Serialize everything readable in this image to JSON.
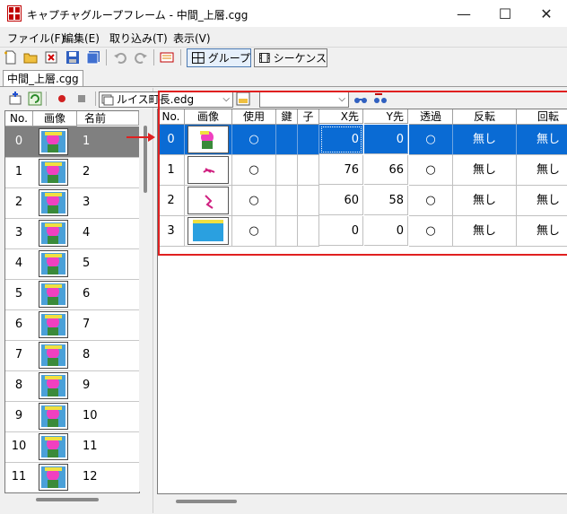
{
  "window": {
    "title": "キャプチャグループフレーム - 中間_上層.cgg"
  },
  "window_controls": {
    "minimize": "—",
    "maximize": "☐",
    "close": "✕"
  },
  "menu": [
    "ファイル(F)",
    "編集(E)",
    "取り込み(T)",
    "表示(V)"
  ],
  "toolbar": {
    "group_label": "グループ",
    "sequence_label": "シーケンス"
  },
  "doc_tab": {
    "label": "中間_上層.cgg"
  },
  "left_panel": {
    "headers": {
      "no": "No.",
      "image": "画像",
      "name": "名前"
    },
    "rows": [
      {
        "no": "0",
        "name": "1",
        "selected": true
      },
      {
        "no": "1",
        "name": "2"
      },
      {
        "no": "2",
        "name": "3"
      },
      {
        "no": "3",
        "name": "4"
      },
      {
        "no": "4",
        "name": "5"
      },
      {
        "no": "5",
        "name": "6"
      },
      {
        "no": "6",
        "name": "7"
      },
      {
        "no": "7",
        "name": "8"
      },
      {
        "no": "8",
        "name": "9"
      },
      {
        "no": "9",
        "name": "10"
      },
      {
        "no": "10",
        "name": "11"
      },
      {
        "no": "11",
        "name": "12"
      }
    ]
  },
  "right_panel": {
    "file_combo": "ルイス町長.edg",
    "second_combo": "",
    "headers": {
      "no": "No.",
      "image": "画像",
      "use": "使用",
      "key": "鍵",
      "child": "子",
      "x": "X先",
      "y": "Y先",
      "transparent": "透過",
      "flip": "反転",
      "rotate": "回転"
    },
    "rows": [
      {
        "no": "0",
        "use": "○",
        "key": "",
        "child": "",
        "x": "0",
        "y": "0",
        "transparent": "○",
        "flip": "無し",
        "rotate": "無し",
        "selected": true
      },
      {
        "no": "1",
        "use": "○",
        "key": "",
        "child": "",
        "x": "76",
        "y": "66",
        "transparent": "○",
        "flip": "無し",
        "rotate": "無し"
      },
      {
        "no": "2",
        "use": "○",
        "key": "",
        "child": "",
        "x": "60",
        "y": "58",
        "transparent": "○",
        "flip": "無し",
        "rotate": "無し"
      },
      {
        "no": "3",
        "use": "○",
        "key": "",
        "child": "",
        "x": "0",
        "y": "0",
        "transparent": "○",
        "flip": "無し",
        "rotate": "無し"
      }
    ]
  },
  "colors": {
    "selection": "#0a6bd4",
    "highlight": "#e02020",
    "left_selected": "#808080"
  }
}
